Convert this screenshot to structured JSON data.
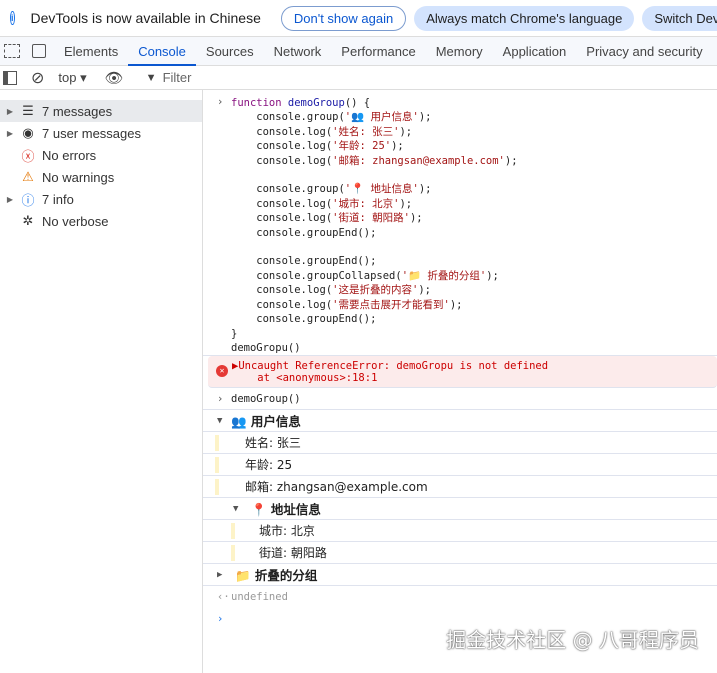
{
  "infobar": {
    "text": "DevTools is now available in Chinese",
    "dont_show": "Don't show again",
    "always_match": "Always match Chrome's language",
    "switch": "Switch Dev"
  },
  "tabs": [
    "Elements",
    "Console",
    "Sources",
    "Network",
    "Performance",
    "Memory",
    "Application",
    "Privacy and security"
  ],
  "toolbar": {
    "context": "top",
    "filter_placeholder": "Filter"
  },
  "sidebar": [
    {
      "label": "7 messages",
      "icon": "list-icon"
    },
    {
      "label": "7 user messages",
      "icon": "user-icon"
    },
    {
      "label": "No errors",
      "icon": "error-icon"
    },
    {
      "label": "No warnings",
      "icon": "warning-icon"
    },
    {
      "label": "7 info",
      "icon": "info-icon"
    },
    {
      "label": "No verbose",
      "icon": "bug-icon"
    }
  ],
  "code": {
    "l1a": "function",
    "l1b": "demoGroup",
    "l1c": "() {",
    "l2a": "    console.group(",
    "l2b": "'👥 用户信息'",
    "l2c": ");",
    "l3a": "    console.log(",
    "l3b": "'姓名: 张三'",
    "l3c": ");",
    "l4a": "    console.log(",
    "l4b": "'年龄: 25'",
    "l4c": ");",
    "l5a": "    console.log(",
    "l5b": "'邮箱: zhangsan@example.com'",
    "l5c": ");",
    "l6a": "    console.group(",
    "l6b": "'📍 地址信息'",
    "l6c": ");",
    "l7a": "    console.log(",
    "l7b": "'城市: 北京'",
    "l7c": ");",
    "l8a": "    console.log(",
    "l8b": "'街道: 朝阳路'",
    "l8c": ");",
    "l9": "    console.groupEnd();",
    "l10": "    console.groupEnd();",
    "l11a": "    console.groupCollapsed(",
    "l11b": "'📁 折叠的分组'",
    "l11c": ");",
    "l12a": "    console.log(",
    "l12b": "'这是折叠的内容'",
    "l12c": ");",
    "l13a": "    console.log(",
    "l13b": "'需要点击展开才能看到'",
    "l13c": ");",
    "l14": "    console.groupEnd();",
    "l15": "}"
  },
  "entries": {
    "typo": "demoGropu()",
    "error1": "▶Uncaught ReferenceError: demoGropu is not defined",
    "error2": "    at <anonymous>:18:1",
    "call": "demoGroup()",
    "g1": "👥 用户信息",
    "name": "姓名: 张三",
    "age": "年龄: 25",
    "email": "邮箱: zhangsan@example.com",
    "g2": "📍 地址信息",
    "city": "城市: 北京",
    "street": "街道: 朝阳路",
    "g3": "📁 折叠的分组",
    "result": "undefined"
  },
  "watermark": "掘金技术社区 @ 八哥程序员"
}
